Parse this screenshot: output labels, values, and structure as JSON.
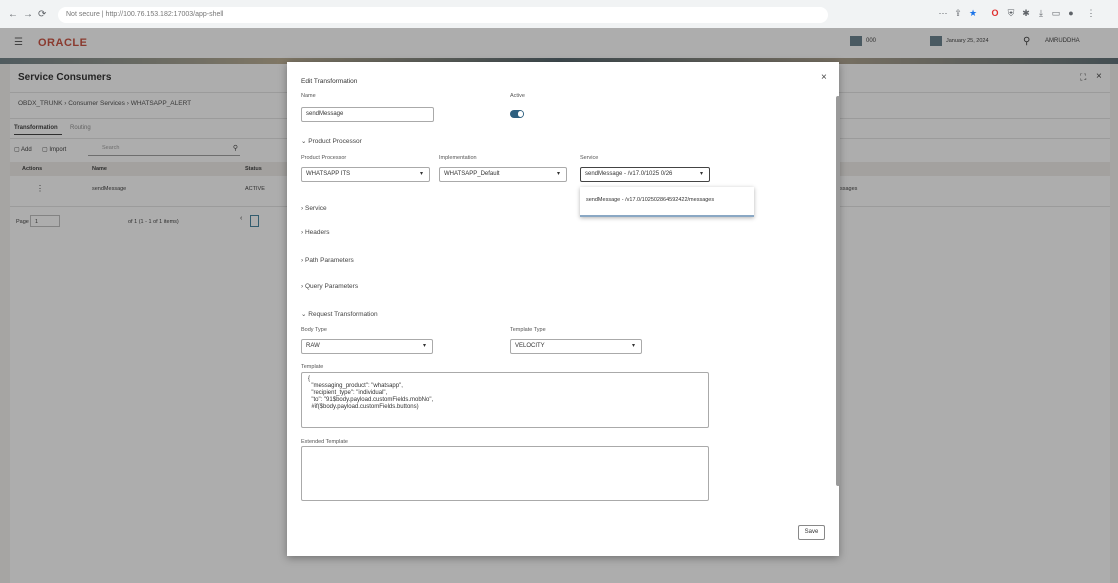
{
  "browser": {
    "address": "Not secure | http://100.76.153.182:17003/app-shell"
  },
  "app": {
    "brand": "ORACLE",
    "user": "AMRUDDHA",
    "branch": "000",
    "date": "January 25, 2024"
  },
  "page": {
    "title": "Service Consumers",
    "breadcrumb": "OBDX_TRUNK  ›  Consumer Services  ›  WHATSAPP_ALERT",
    "tabs": [
      "Transformation",
      "Routing"
    ],
    "add_label": "Add",
    "import_label": "Import",
    "search_placeholder": "Search",
    "columns": [
      "Actions",
      "Name",
      "Status"
    ],
    "row": {
      "name": "sendMessage",
      "status": "ACTIVE",
      "extra": "ssages"
    },
    "pager": {
      "page_label": "Page",
      "page_value": "1",
      "of_text": "of 1  (1 - 1 of 1 items)"
    }
  },
  "modal": {
    "heading": "Edit Transformation",
    "name_label": "Name",
    "name_value": "sendMessage",
    "active_label": "Active",
    "product_processor_section": "Product Processor",
    "pp_label": "Product Processor",
    "pp_value": "WHATSAPP ITS",
    "impl_label": "Implementation",
    "impl_value": "WHATSAPP_Default",
    "service_label": "Service",
    "service_value": "sendMessage - /v17.0/1025 0/26",
    "service_option": "sendMessage - /v17.0/102502864592422/messages",
    "sections": [
      "Service",
      "Headers",
      "Path Parameters",
      "Query Parameters"
    ],
    "request_section": "Request Transformation",
    "body_type_label": "Body Type",
    "body_type_value": "RAW",
    "template_type_label": "Template Type",
    "template_type_value": "VELOCITY",
    "template_label": "Template",
    "template_lines": [
      "{",
      "  \"messaging_product\": \"whatsapp\",",
      "  \"recipient_type\": \"individual\",",
      "  \"to\": \"91$body.payload.customFields.mobNo\",",
      "  #if($body.payload.customFields.buttons)"
    ],
    "extended_label": "Extended Template",
    "save_label": "Save"
  }
}
